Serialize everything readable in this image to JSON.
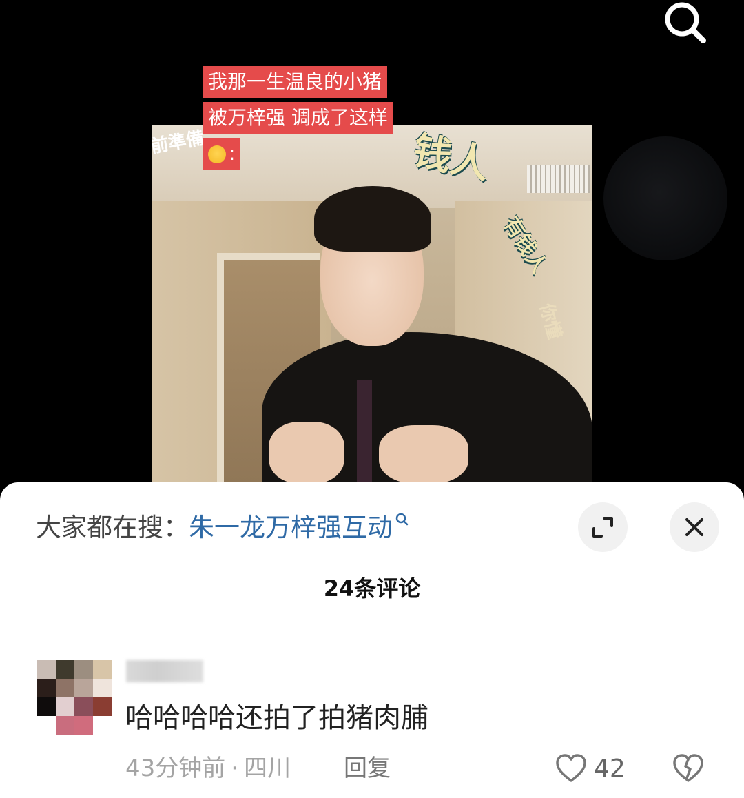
{
  "video": {
    "caption_lines": [
      "我那一生温良的小猪",
      "被万梓强 调成了这样",
      ":"
    ],
    "overlay_texts": [
      "钱人",
      "有钱人",
      "前準備",
      "你懂"
    ]
  },
  "panel": {
    "suggest_label": "大家都在搜：",
    "suggest_query": "朱一龙万梓强互动",
    "comments_title": "24条评论"
  },
  "comment": {
    "text": "哈哈哈哈还拍了拍猪肉脯",
    "time": "43分钟前",
    "separator": "·",
    "location": "四川",
    "reply_label": "回复",
    "like_count": "42"
  },
  "colors": {
    "caption_bg": "#e54b4b",
    "link_blue": "#2f6aa6",
    "meta_gray": "#a4a4a4"
  },
  "icons": {
    "search": "search-icon",
    "expand": "expand-icon",
    "close": "close-icon",
    "like": "heart-icon",
    "dislike": "broken-heart-icon"
  }
}
